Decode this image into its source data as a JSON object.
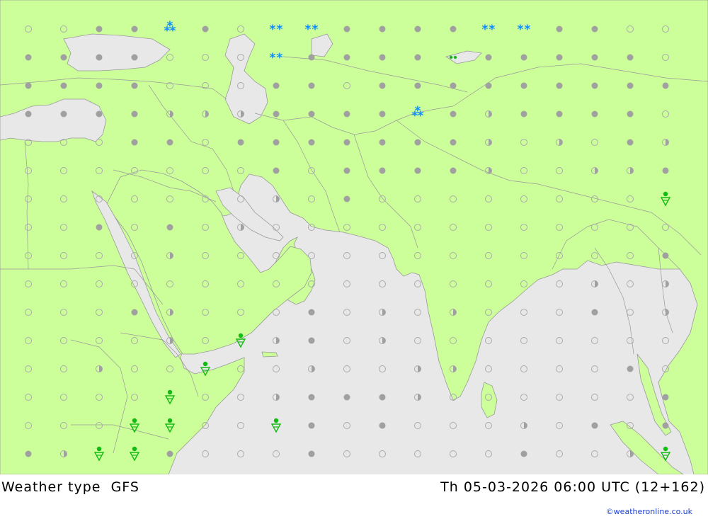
{
  "header": {
    "product": "Weather type",
    "model": "GFS"
  },
  "valid_time": "Th 05-03-2026 06:00 UTC (12+162)",
  "credit": "©weatheronline.co.uk",
  "colors": {
    "land": "#ccff99",
    "sea": "#e8e8e8",
    "border": "#999999",
    "dot_filled": "#a0a0a0",
    "dot_open": "#aaaaaa",
    "snow": "#0a8cff",
    "rain": "#11bb11"
  },
  "legend_icons": [
    "cloud-dot",
    "open-dot",
    "half-dot",
    "snow-icon",
    "rain-shower-icon",
    "drizzle-icon"
  ],
  "grid": {
    "columns": 19,
    "rows": 16,
    "cells": [
      "o.o.f.f.s.f.o.S.S.f.f.f.f.S.S.f.f.o.o",
      "f.f.f.f.o.o.o.S.f.f.f.f.d.f.f.f.f.f.o",
      "f.f.f.f.o.o.o.f.f.o.f.f.f.f.f.f.f.f.f",
      "f.f.f.f.h.h.h.f.f.f.f.s.f.h.f.f.f.f.o",
      "o.o.o.f.f.o.f.f.f.f.f.f.f.h.o.h.o.f.h",
      "o.o.o.o.o.o.o.f.o.f.f.f.f.h.o.o.h.h.f",
      "o.o.o.o.o.o.o.h.o.f.o.o.o.o.o.o.o.o.r",
      "o.o.f.o.f.o.h.o.o.o.o.o.o.o.o.o.o.o.o",
      "o.o.o.o.h.o.o.o.o.o.o.o.o.o.o.o.o.o.f",
      "o.o.o.o.o.o.o.o.o.o.o.o.o.o.o.o.h.o.h",
      "o.o.o.f.h.o.o.o.f.o.h.o.h.o.o.o.f.o.h",
      "o.o.o.o.h.o.r.h.f.o.h.o.o.o.o.o.o.o.o",
      "o.o.h.o.o.r.o.o.h.o.o.h.h.o.o.o.o.f.o",
      "o.o.o.o.r.o.o.h.f.f.f.h.o.o.o.o.o.o.f",
      "o.o.o.r.r.o.o.r.f.o.f.o.o.o.h.o.f.o.f",
      "f.h.r.r.f.o.o.o.f.o.o.o.o.o.f.o.o.h.r"
    ]
  }
}
